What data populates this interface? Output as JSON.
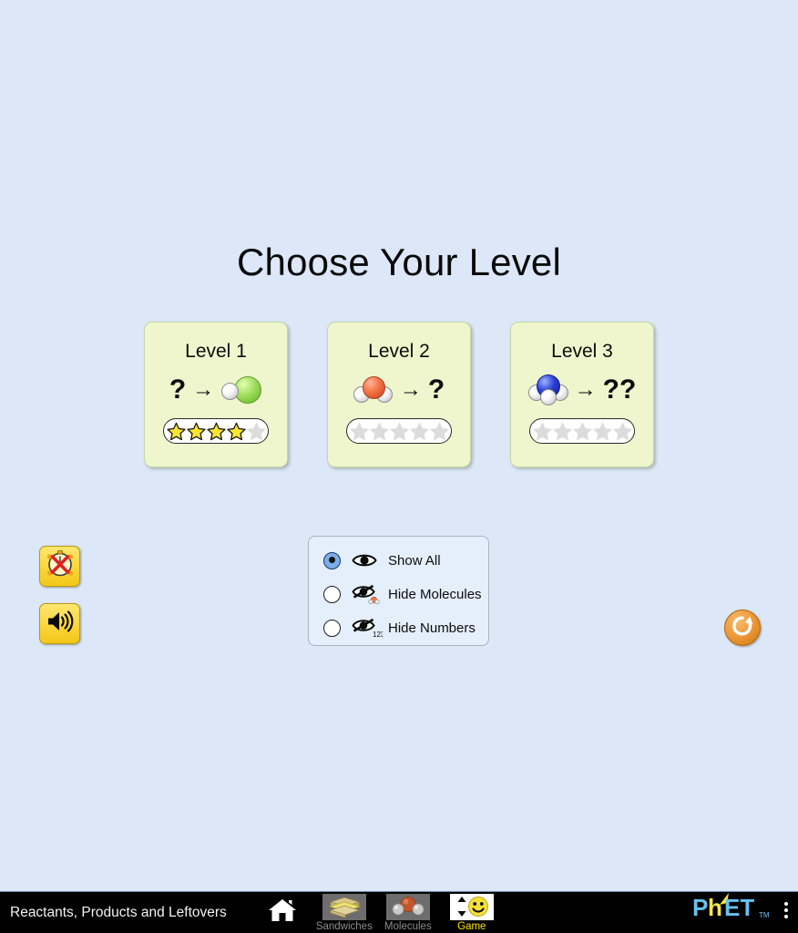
{
  "app": {
    "sim_name": "Reactants, Products and Leftovers",
    "background_color": "#dce7f8"
  },
  "screen": {
    "title": "Choose Your Level"
  },
  "levels": [
    {
      "label": "Level 1",
      "reaction_left": "?",
      "arrow": "→",
      "reaction_right_type": "molecule-hcl",
      "reaction_right": "",
      "stars_filled": 4,
      "stars_total": 5,
      "card_color": "#eff6cd"
    },
    {
      "label": "Level 2",
      "reaction_left_type": "molecule-h2o",
      "reaction_left": "",
      "arrow": "→",
      "reaction_right": "?",
      "stars_filled": 0,
      "stars_total": 5,
      "card_color": "#eff6cd"
    },
    {
      "label": "Level 3",
      "reaction_left_type": "molecule-nh3",
      "reaction_left": "",
      "arrow": "→",
      "reaction_right": "??",
      "stars_filled": 0,
      "stars_total": 5,
      "card_color": "#eff6cd"
    }
  ],
  "visibility_panel": {
    "options": [
      {
        "label": "Show All",
        "icon": "eye-icon",
        "selected": true
      },
      {
        "label": "Hide Molecules",
        "icon": "eye-slash-molecule-icon",
        "selected": false
      },
      {
        "label": "Hide Numbers",
        "icon": "eye-slash-numbers-icon",
        "selected": false
      }
    ],
    "numbers_icon_text": "123"
  },
  "controls": {
    "timer_button": "timer-off-icon",
    "sound_button": "sound-on-icon",
    "reset_all_button": "reset-all-icon",
    "button_color": "#fcd942",
    "reset_color": "#ef9b3b"
  },
  "navbar": {
    "home_button": "home-icon",
    "tabs": [
      {
        "label": "Sandwiches",
        "icon": "sandwich-icon",
        "active": false
      },
      {
        "label": "Molecules",
        "icon": "molecule-icon",
        "active": false
      },
      {
        "label": "Game",
        "icon": "game-smiley-icon",
        "active": true
      }
    ],
    "logo": "phet-logo",
    "menu": "kebab-menu-icon",
    "logo_colors": {
      "blue": "#6ec6f0",
      "yellow": "#fbe74a"
    },
    "active_tab_label_color": "#ffe400"
  }
}
